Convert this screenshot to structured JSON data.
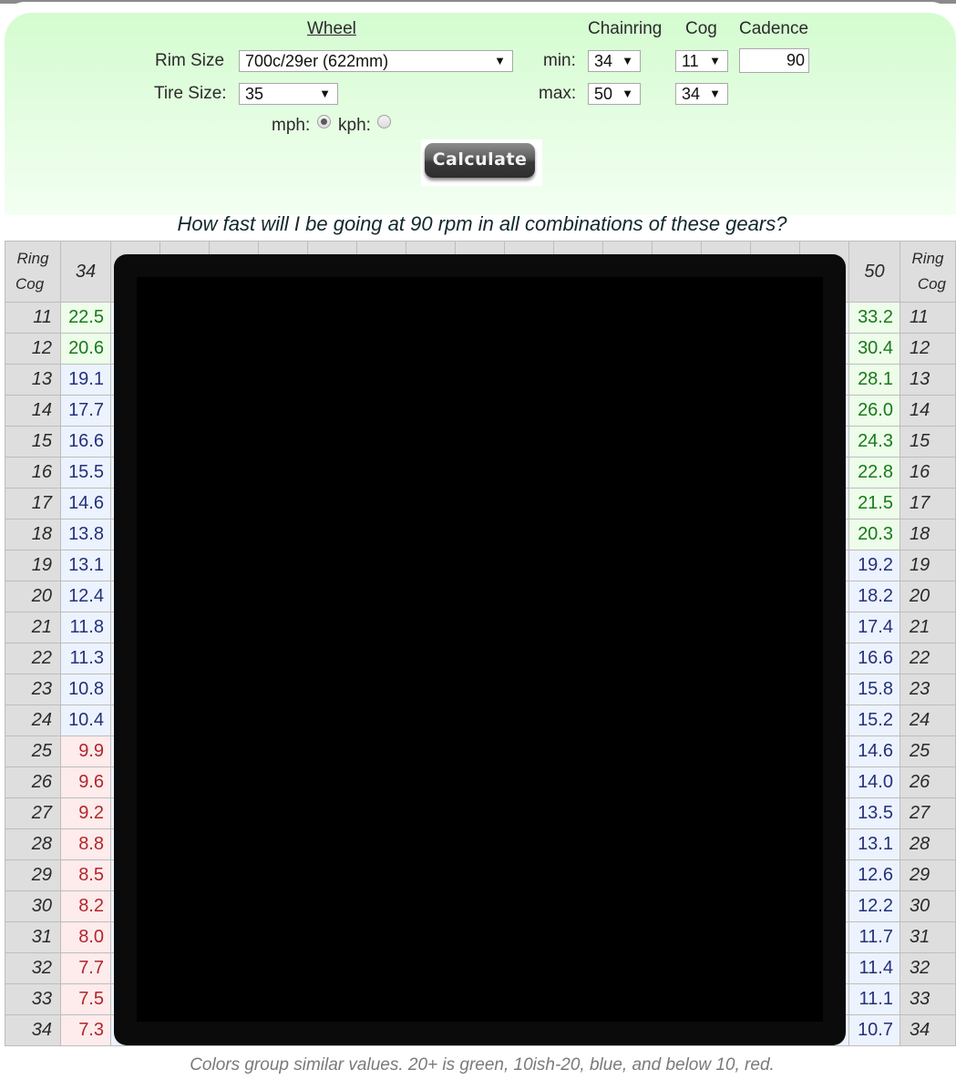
{
  "form": {
    "wheel_heading": "Wheel",
    "rim_size_label": "Rim Size",
    "rim_size_value": "700c/29er (622mm)",
    "tire_size_label": "Tire Size:",
    "tire_size_value": "35",
    "units": {
      "mph_label": "mph:",
      "kph_label": "kph:",
      "selected": "mph"
    },
    "chainring_heading": "Chainring",
    "cog_heading": "Cog",
    "cadence_heading": "Cadence",
    "min_label": "min:",
    "max_label": "max:",
    "chainring_min": "34",
    "chainring_max": "50",
    "cog_min": "11",
    "cog_max": "34",
    "cadence_value": "90",
    "calculate_label": "Calculate",
    "dropdown_arrow": "▼"
  },
  "question": "How fast will I be going at 90 rpm in all combinations of these gears?",
  "table": {
    "corner_ring": "Ring",
    "corner_cog": "Cog",
    "visible_rings": [
      "34",
      "50"
    ],
    "cogs": [
      "11",
      "12",
      "13",
      "14",
      "15",
      "16",
      "17",
      "18",
      "19",
      "20",
      "21",
      "22",
      "23",
      "24",
      "25",
      "26",
      "27",
      "28",
      "29",
      "30",
      "31",
      "32",
      "33",
      "34"
    ],
    "ring_34": [
      "22.5",
      "20.6",
      "19.1",
      "17.7",
      "16.6",
      "15.5",
      "14.6",
      "13.8",
      "13.1",
      "12.4",
      "11.8",
      "11.3",
      "10.8",
      "10.4",
      "9.9",
      "9.6",
      "9.2",
      "8.8",
      "8.5",
      "8.2",
      "8.0",
      "7.7",
      "7.5",
      "7.3"
    ],
    "ring_50": [
      "33.2",
      "30.4",
      "28.1",
      "26.0",
      "24.3",
      "22.8",
      "21.5",
      "20.3",
      "19.2",
      "18.2",
      "17.4",
      "16.6",
      "15.8",
      "15.2",
      "14.6",
      "14.0",
      "13.5",
      "13.1",
      "12.6",
      "12.2",
      "11.7",
      "11.4",
      "11.1",
      "10.7"
    ],
    "hidden_columns_count": 15
  },
  "color_legend": {
    "green": "#1a7a1a",
    "blue": "#24317a",
    "red": "#b2262d"
  },
  "note": "Colors group similar values. 20+ is green, 10ish-20, blue, and below 10, red."
}
